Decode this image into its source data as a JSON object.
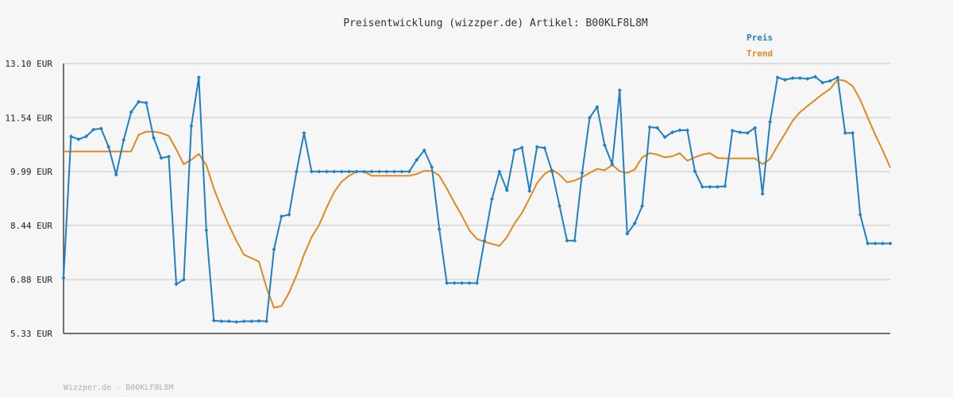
{
  "chart_data": {
    "type": "line",
    "title": "Preisentwicklung (wizzper.de) Artikel: B00KLF8L8M",
    "footer": "Wizzper.de - B00KLF8L8M",
    "ylim": [
      5.33,
      13.1
    ],
    "yticks": [
      "13.10 EUR",
      "11.54 EUR",
      "9.99 EUR",
      "8.44 EUR",
      "6.88 EUR",
      "5.33 EUR"
    ],
    "ytick_values": [
      13.1,
      11.54,
      9.99,
      8.44,
      6.88,
      5.33
    ],
    "grid": true,
    "legend_position": "top-right",
    "colors": {
      "preis": "#1f7fc5",
      "trend": "#e08a1e"
    },
    "series": [
      {
        "name": "Preis",
        "values": [
          6.93,
          11.0,
          10.92,
          11.0,
          11.2,
          11.23,
          10.7,
          9.9,
          10.9,
          11.7,
          12.0,
          11.97,
          10.96,
          10.38,
          10.42,
          6.75,
          6.88,
          11.3,
          12.7,
          8.3,
          5.7,
          5.68,
          5.68,
          5.66,
          5.68,
          5.68,
          5.69,
          5.68,
          7.75,
          8.7,
          8.75,
          9.99,
          11.1,
          9.99,
          9.99,
          9.99,
          9.99,
          9.99,
          9.99,
          9.99,
          9.99,
          9.99,
          9.99,
          9.99,
          9.99,
          9.99,
          9.99,
          10.33,
          10.6,
          10.12,
          8.33,
          6.78,
          6.78,
          6.78,
          6.78,
          6.78,
          8.0,
          9.2,
          9.99,
          9.45,
          10.6,
          10.68,
          9.43,
          10.7,
          10.67,
          9.99,
          9.0,
          8.0,
          8.0,
          9.95,
          11.54,
          11.85,
          10.75,
          10.2,
          12.33,
          8.2,
          8.5,
          9.0,
          11.27,
          11.25,
          10.98,
          11.12,
          11.18,
          11.18,
          10.0,
          9.55,
          9.55,
          9.55,
          9.57,
          11.17,
          11.12,
          11.1,
          11.25,
          9.35,
          11.42,
          12.7,
          12.63,
          12.68,
          12.68,
          12.66,
          12.72,
          12.55,
          12.6,
          12.7,
          11.1,
          11.1,
          8.75,
          7.92,
          7.92,
          7.92,
          7.92
        ]
      },
      {
        "name": "Trend",
        "values": [
          10.57,
          10.57,
          10.57,
          10.57,
          10.57,
          10.57,
          10.57,
          10.57,
          10.57,
          10.57,
          11.05,
          11.14,
          11.14,
          11.1,
          11.02,
          10.63,
          10.2,
          10.33,
          10.5,
          10.18,
          9.5,
          8.95,
          8.45,
          8.0,
          7.6,
          7.5,
          7.4,
          6.65,
          6.07,
          6.12,
          6.5,
          7.0,
          7.6,
          8.1,
          8.45,
          8.95,
          9.4,
          9.7,
          9.87,
          9.99,
          9.99,
          9.87,
          9.87,
          9.87,
          9.87,
          9.87,
          9.87,
          9.92,
          10.01,
          10.01,
          9.87,
          9.5,
          9.1,
          8.72,
          8.3,
          8.05,
          7.97,
          7.91,
          7.85,
          8.1,
          8.5,
          8.8,
          9.22,
          9.66,
          9.92,
          10.05,
          9.9,
          9.68,
          9.73,
          9.83,
          9.95,
          10.07,
          10.03,
          10.18,
          10.0,
          9.95,
          10.05,
          10.4,
          10.52,
          10.48,
          10.4,
          10.43,
          10.52,
          10.3,
          10.4,
          10.48,
          10.52,
          10.38,
          10.37,
          10.37,
          10.37,
          10.37,
          10.37,
          10.2,
          10.35,
          10.73,
          11.08,
          11.45,
          11.7,
          11.88,
          12.05,
          12.22,
          12.37,
          12.64,
          12.6,
          12.45,
          12.06,
          11.55,
          11.05,
          10.6,
          10.1
        ]
      }
    ]
  }
}
